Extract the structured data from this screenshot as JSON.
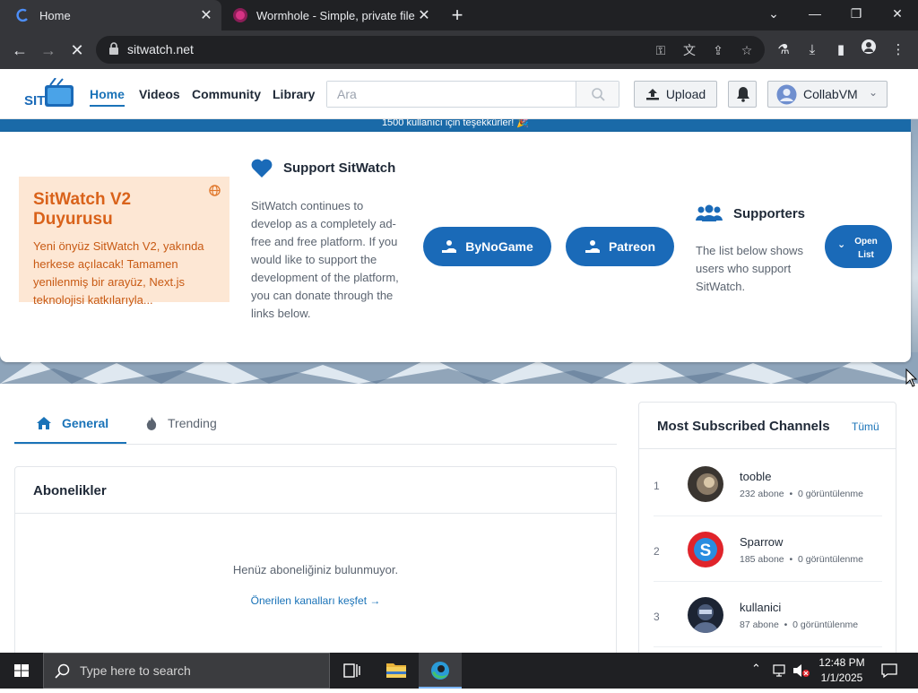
{
  "browser": {
    "tabs": [
      {
        "title": "Home",
        "active": true
      },
      {
        "title": "Wormhole - Simple, private file sharing",
        "active": false
      }
    ],
    "url": "sitwatch.net"
  },
  "header": {
    "nav": [
      "Home",
      "Videos",
      "Community",
      "Library"
    ],
    "search_placeholder": "Ara",
    "upload_label": "Upload",
    "user_name": "CollabVM"
  },
  "hero": {
    "announce_strip": "1500 kullanıcı için teşekkürler! 🎉",
    "v2_title": "SitWatch V2 Duyurusu",
    "v2_text": "Yeni önyüz SitWatch V2, yakında herkese açılacak! Tamamen yenilenmiş bir arayüz, Next.js teknolojisi katkılarıyla...",
    "support_title": "Support SitWatch",
    "support_text": "SitWatch continues to develop as a completely ad-free and free platform. If you would like to support the development of the platform, you can donate through the links below.",
    "donate_buttons": [
      "ByNoGame",
      "Patreon"
    ],
    "supporters_title": "Supporters",
    "supporters_text": "The list below shows users who support SitWatch.",
    "open_list_label": "Open List"
  },
  "content": {
    "tabs": [
      "General",
      "Trending"
    ],
    "subscriptions": {
      "title": "Abonelikler",
      "empty_text": "Henüz aboneliğiniz bulunmuyor.",
      "discover_link": "Önerilen kanalları keşfet →"
    },
    "channels": {
      "title": "Most Subscribed Channels",
      "see_all": "Tümü",
      "items": [
        {
          "rank": "1",
          "name": "tooble",
          "subs": "232 abone",
          "views": "0 görüntülenme"
        },
        {
          "rank": "2",
          "name": "Sparrow",
          "subs": "185 abone",
          "views": "0 görüntülenme"
        },
        {
          "rank": "3",
          "name": "kullanici",
          "subs": "87 abone",
          "views": "0 görüntülenme"
        }
      ]
    }
  },
  "taskbar": {
    "search_placeholder": "Type here to search",
    "time": "12:48 PM",
    "date": "1/1/2025"
  },
  "colors": {
    "brand": "#1a73b8",
    "button": "#1a6ab8",
    "announce_bg": "#fde7d4",
    "announce_text": "#d9621a"
  }
}
